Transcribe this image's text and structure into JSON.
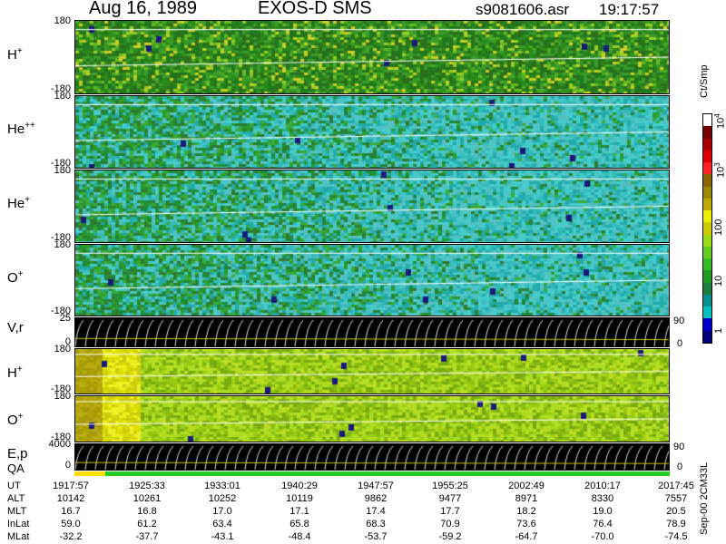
{
  "header": {
    "date_label": "Aug 16, 1989",
    "instrument": "EXOS-D SMS",
    "file_name": "s9081606.asr",
    "time": "19:17:57"
  },
  "panels": [
    {
      "id": "h_plus_1",
      "label": "H",
      "charge": "+",
      "ymax": "180",
      "ymin": "-180",
      "palette": "green-yellow-dark"
    },
    {
      "id": "he_pp",
      "label": "He",
      "charge": "++",
      "ymax": "180",
      "ymin": "-180",
      "palette": "cyan-green"
    },
    {
      "id": "he_plus",
      "label": "He",
      "charge": "+",
      "ymax": "180",
      "ymin": "-180",
      "palette": "cyan-green"
    },
    {
      "id": "o_plus_1",
      "label": "O",
      "charge": "+",
      "ymax": "180",
      "ymin": "-180",
      "palette": "cyan-green"
    },
    {
      "id": "vr",
      "label": "V,r",
      "charge": "",
      "ymax": "25",
      "ymin": "0",
      "rmax": "90",
      "rmin": "0",
      "palette": "black-lines"
    },
    {
      "id": "h_plus_2",
      "label": "H",
      "charge": "+",
      "ymax": "180",
      "ymin": "-180",
      "palette": "yellow-green"
    },
    {
      "id": "o_plus_2",
      "label": "O",
      "charge": "+",
      "ymax": "180",
      "ymin": "-180",
      "palette": "yellow-green"
    },
    {
      "id": "ep",
      "label": "E,p",
      "charge": "",
      "ymax": "4000",
      "ymin": "0",
      "rmax": "90",
      "rmin": "0",
      "palette": "black-lines"
    }
  ],
  "qa_label": "QA",
  "colorbar": {
    "title": "Ct/Smp",
    "ticks": [
      {
        "text": "1",
        "pos": 1
      },
      {
        "text": "10",
        "pos": 2
      },
      {
        "text": "100",
        "pos": 3
      },
      {
        "text": "3",
        "pos": 4
      },
      {
        "text": "4",
        "pos": 5
      }
    ],
    "tick_prefix": "10",
    "colors": [
      "#00007a",
      "#0000c8",
      "#00c0c0",
      "#009090",
      "#1a8040",
      "#1f9a1f",
      "#33bb22",
      "#66cc22",
      "#99dd11",
      "#cccc00",
      "#eeee00",
      "#bbaa00",
      "#998800",
      "#886600",
      "#ff2020",
      "#dd0000",
      "#aa0000",
      "#770000",
      "#ffffff"
    ]
  },
  "chart_data": {
    "type": "heatmap",
    "x_label_rows": [
      "UT",
      "ALT",
      "MLT",
      "InLat",
      "MLat"
    ],
    "x_ticks": [
      "1917:57",
      "1925:33",
      "1933:01",
      "1940:29",
      "1947:57",
      "1955:25",
      "2002:49",
      "2010:17",
      "2017:45"
    ],
    "alt": [
      "10142",
      "10261",
      "10252",
      "10119",
      "9862",
      "9477",
      "8971",
      "8330",
      "7557"
    ],
    "mlt": [
      "16.7",
      "16.8",
      "17.0",
      "17.1",
      "17.4",
      "17.7",
      "18.2",
      "19.0",
      "20.5"
    ],
    "inlat": [
      "59.0",
      "61.2",
      "63.4",
      "65.8",
      "68.3",
      "70.9",
      "73.6",
      "76.4",
      "78.9"
    ],
    "mlat": [
      "-32.2",
      "-37.7",
      "-43.1",
      "-48.4",
      "-53.7",
      "-59.2",
      "-64.7",
      "-70.0",
      "-74.5"
    ]
  },
  "footer": {
    "version": "Sep-00 2CM33L"
  }
}
